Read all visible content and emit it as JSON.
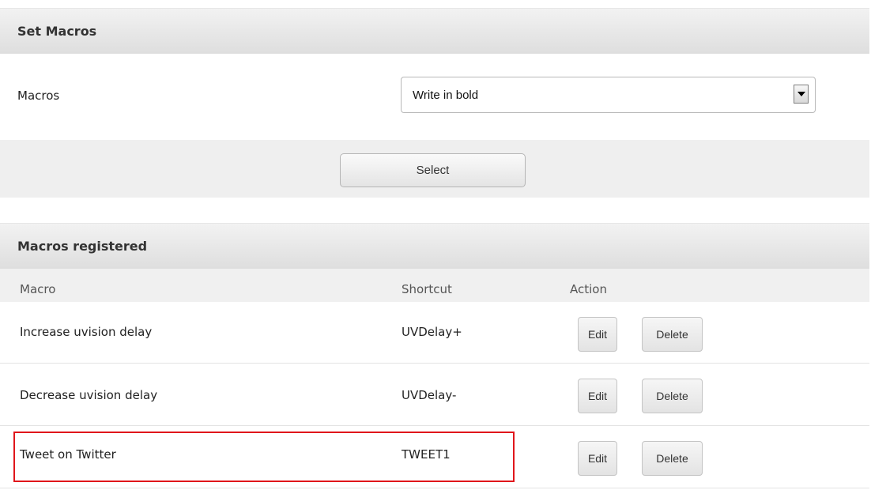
{
  "set_macros": {
    "title": "Set Macros",
    "macros_label": "Macros",
    "select_value": "Write in bold",
    "select_button": "Select"
  },
  "registered": {
    "title": "Macros registered",
    "columns": {
      "macro": "Macro",
      "shortcut": "Shortcut",
      "action": "Action"
    },
    "rows": [
      {
        "macro": "Increase uvision delay",
        "shortcut": "UVDelay+",
        "edit": "Edit",
        "delete": "Delete"
      },
      {
        "macro": "Decrease uvision delay",
        "shortcut": "UVDelay-",
        "edit": "Edit",
        "delete": "Delete"
      },
      {
        "macro": "Tweet on Twitter",
        "shortcut": "TWEET1",
        "edit": "Edit",
        "delete": "Delete"
      }
    ],
    "highlighted_row": 2,
    "highlight_color": "#e0161b"
  }
}
